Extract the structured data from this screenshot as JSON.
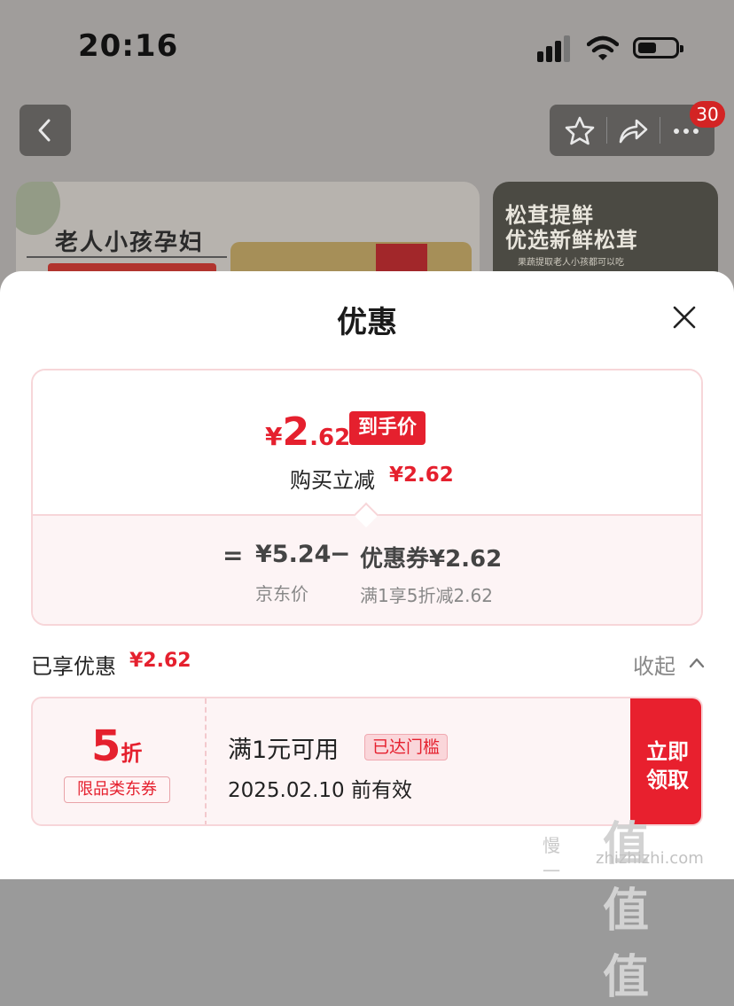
{
  "status_bar": {
    "time": "20:16"
  },
  "background": {
    "badge_count": "30",
    "banner_left_text": "老人小孩孕妇",
    "banner_right_line1": "松茸提鲜",
    "banner_right_line2": "优选新鲜松茸",
    "banner_right_small": "果蔬提取老人小孩都可以吃"
  },
  "sheet": {
    "title": "优惠",
    "final_price": {
      "yen": "¥",
      "integer": "2",
      "decimal": ".62",
      "tag": "到手价"
    },
    "instant_discount": {
      "label": "购买立减",
      "value": "¥2.62"
    },
    "breakdown": {
      "equals": "=",
      "jd_price": "¥5.24",
      "minus": "−",
      "coupon_price": "优惠券¥2.62",
      "jd_label": "京东价",
      "coupon_label": "满1享5折减2.62"
    },
    "enjoyed": {
      "label": "已享优惠",
      "value": "¥2.62",
      "collapse_label": "收起"
    },
    "coupon": {
      "discount_num": "5",
      "discount_unit": "折",
      "type_tag": "限品类东券",
      "condition": "满1元可用",
      "reached_tag": "已达门槛",
      "validity": "2025.02.10 前有效",
      "claim_line1": "立即",
      "claim_line2": "领取"
    }
  },
  "watermark": {
    "mark": "值值值",
    "left": "慢一",
    "site": "zhizhizhi.com"
  },
  "colors": {
    "accent": "#e5202e",
    "card_border": "#f7d6d9",
    "card_bg": "#fdf4f5"
  }
}
